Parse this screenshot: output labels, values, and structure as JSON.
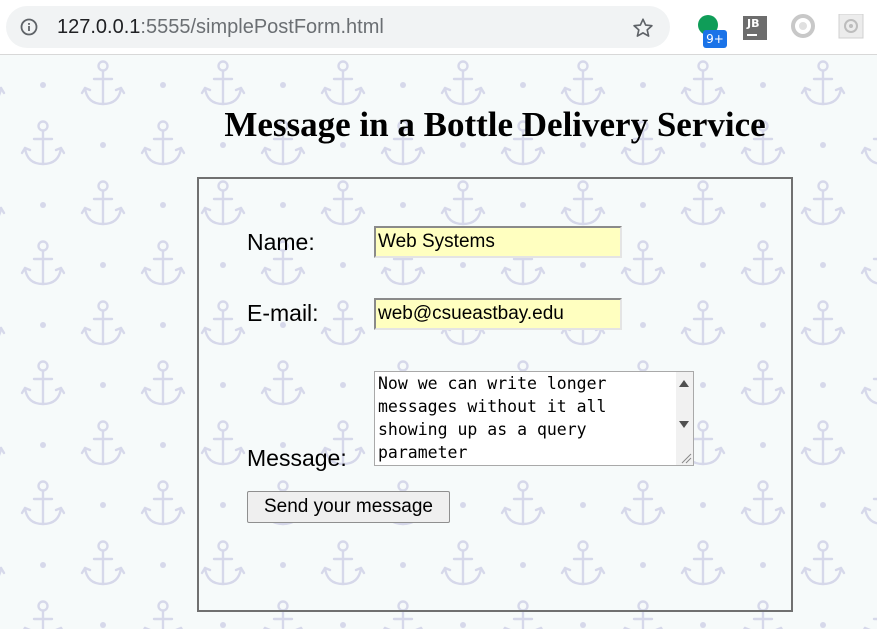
{
  "browser": {
    "url_host": "127.0.0.1",
    "url_rest": ":5555/simplePostForm.html",
    "extensions": {
      "badge_count": "9+",
      "jb_label": "JB"
    }
  },
  "page": {
    "title": "Message in a Bottle Delivery Service",
    "form": {
      "name_label": "Name:",
      "name_value": "Web Systems",
      "email_label": "E-mail:",
      "email_value": "web@csueastbay.edu",
      "message_label": "Message:",
      "message_value": "Now we can write longer messages without it all showing up as a query parameter",
      "submit_label": "Send your message"
    }
  },
  "colors": {
    "input_bg": "#ffffc0",
    "page_bg": "#f6fafa",
    "pattern": "#d6d8ea"
  }
}
